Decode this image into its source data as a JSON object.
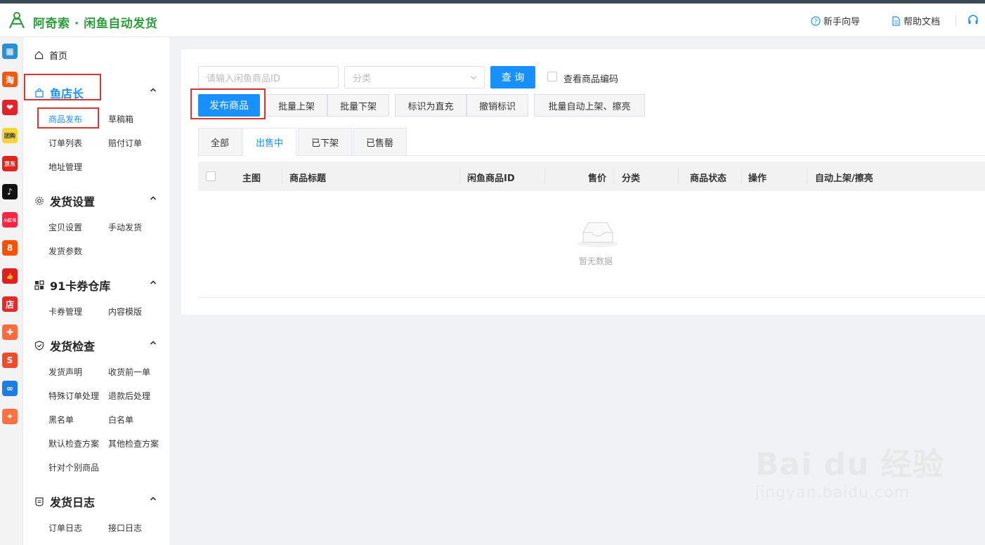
{
  "header": {
    "title": "阿奇索 · 闲鱼自动发货",
    "links": [
      "新手向导",
      "帮助文档"
    ]
  },
  "rail": {
    "icons": [
      {
        "name": "grid-app-icon",
        "color": "#2b8fd6",
        "glyph": "▦"
      },
      {
        "name": "taobao-icon",
        "color": "#f25a12",
        "glyph": "淘"
      },
      {
        "name": "pinduoduo-icon",
        "color": "#e3232c",
        "glyph": "❤"
      },
      {
        "name": "meituan-icon",
        "color": "#f7d53a",
        "glyph": "团购"
      },
      {
        "name": "jd-icon",
        "color": "#e1251b",
        "glyph": "京东"
      },
      {
        "name": "douyin-icon",
        "color": "#111111",
        "glyph": "♪"
      },
      {
        "name": "xiaohongshu-icon",
        "color": "#ff2442",
        "glyph": "小红书"
      },
      {
        "name": "kuaishou-icon",
        "color": "#ff5000",
        "glyph": "8"
      },
      {
        "name": "thumbs-up-icon",
        "color": "#e02020",
        "glyph": "👍"
      },
      {
        "name": "shop-icon",
        "color": "#e12b2b",
        "glyph": "店"
      },
      {
        "name": "bag-icon",
        "color": "#ff6a3c",
        "glyph": "✚"
      },
      {
        "name": "shopee-icon",
        "color": "#ee4d2d",
        "glyph": "S"
      },
      {
        "name": "link-icon",
        "color": "#1e7ce6",
        "glyph": "∞"
      },
      {
        "name": "gift-bag-icon",
        "color": "#ff7043",
        "glyph": "✦"
      }
    ]
  },
  "menu": {
    "home": "首页",
    "groups": [
      {
        "title": "鱼店长",
        "items": [
          "商品发布",
          "草稿箱",
          "订单列表",
          "赔付订单",
          "地址管理"
        ]
      },
      {
        "title": "发货设置",
        "items": [
          "宝贝设置",
          "手动发货",
          "发货参数"
        ]
      },
      {
        "title": "91卡券仓库",
        "items": [
          "卡券管理",
          "内容模版"
        ]
      },
      {
        "title": "发货检查",
        "items": [
          "发货声明",
          "收货前一单",
          "特殊订单处理",
          "退款后处理",
          "黑名单",
          "白名单",
          "默认检查方案",
          "其他检查方案",
          "针对个别商品"
        ]
      },
      {
        "title": "发货日志",
        "items": [
          "订单日志",
          "接口日志"
        ]
      }
    ]
  },
  "search": {
    "id_placeholder": "请输入闲鱼商品ID",
    "category_placeholder": "分类",
    "query_label": "查 询",
    "view_code_label": "查看商品编码"
  },
  "toolbar": {
    "publish": "发布商品",
    "batch_up": "批量上架",
    "batch_down": "批量下架",
    "mark_recharge": "标识为直充",
    "cancel_mark": "撤销标识",
    "batch_auto": "批量自动上架、擦亮"
  },
  "tabs": [
    "全部",
    "出售中",
    "已下架",
    "已售罄"
  ],
  "active_tab": "出售中",
  "table": {
    "columns": [
      "主图",
      "商品标题",
      "闲鱼商品ID",
      "售价",
      "分类",
      "商品状态",
      "操作",
      "自动上架/擦亮"
    ],
    "empty_text": "暂无数据"
  },
  "watermark": {
    "brand": "Bai du 经验",
    "url": "jingyan.baidu.com"
  },
  "colors": {
    "primary": "#1890ff",
    "brand_green": "#2e9b3d",
    "highlight_red": "#d8372f"
  }
}
